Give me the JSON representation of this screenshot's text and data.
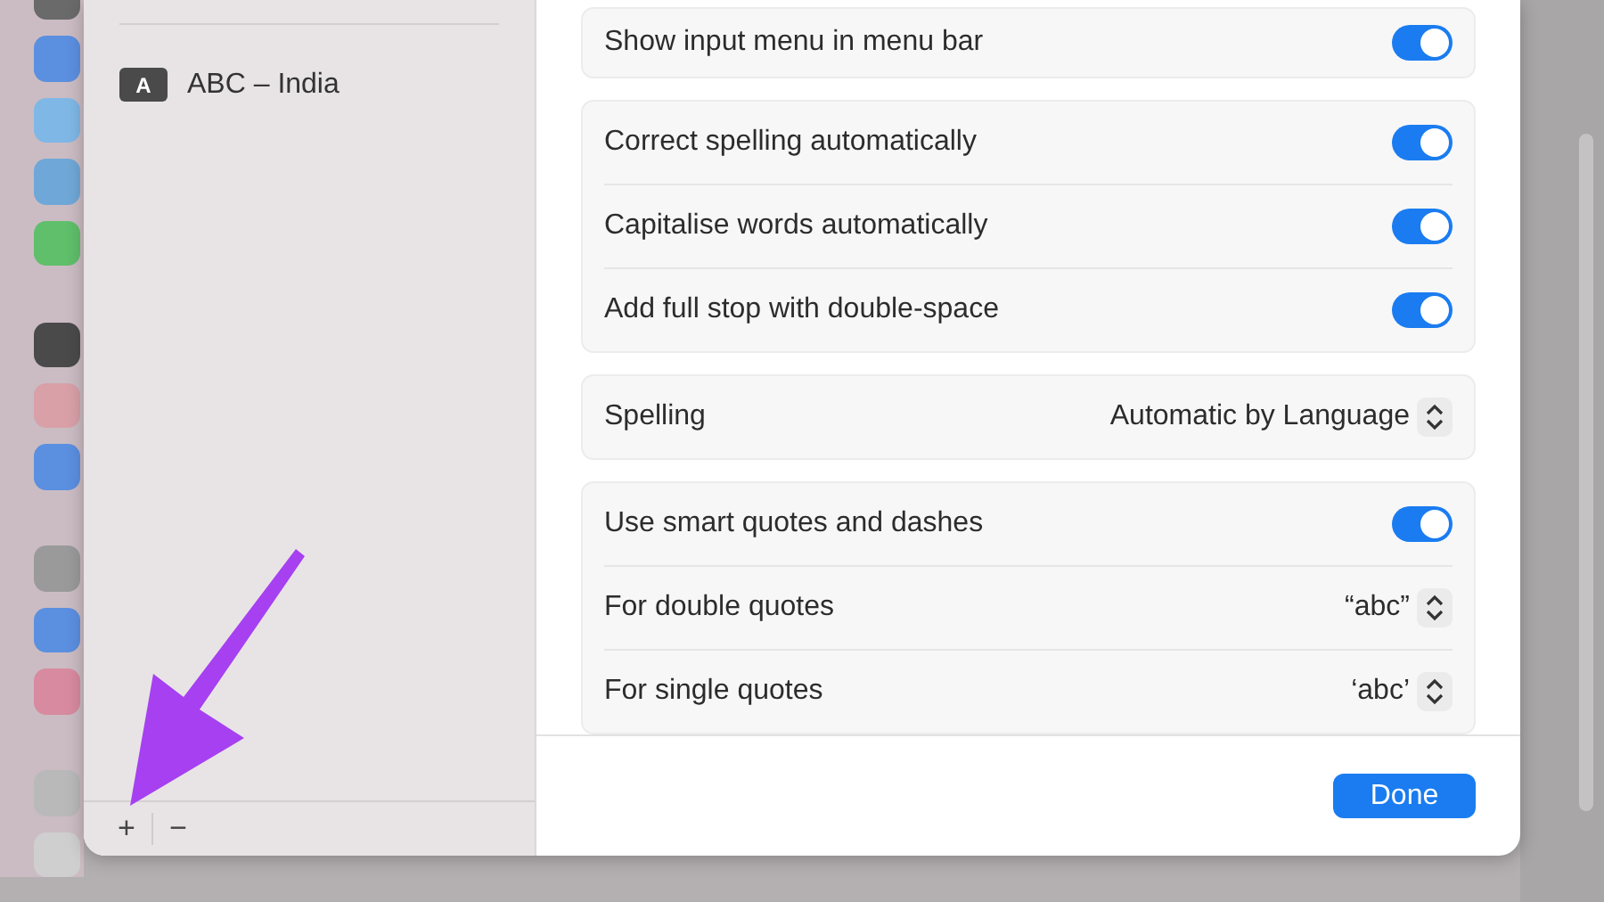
{
  "sidebar": {
    "input_sources": [
      {
        "badge": "A",
        "label": "ABC – India"
      }
    ],
    "add_button": "+",
    "remove_button": "−"
  },
  "settings_groups": [
    {
      "rows": [
        {
          "kind": "toggle",
          "label": "Show input menu in menu bar",
          "on": true
        }
      ]
    },
    {
      "rows": [
        {
          "kind": "toggle",
          "label": "Correct spelling automatically",
          "on": true
        },
        {
          "kind": "toggle",
          "label": "Capitalise words automatically",
          "on": true
        },
        {
          "kind": "toggle",
          "label": "Add full stop with double-space",
          "on": true
        }
      ]
    },
    {
      "rows": [
        {
          "kind": "popup",
          "label": "Spelling",
          "value": "Automatic by Language"
        }
      ]
    },
    {
      "rows": [
        {
          "kind": "toggle",
          "label": "Use smart quotes and dashes",
          "on": true
        },
        {
          "kind": "popup",
          "label": "For double quotes",
          "value": "“abc”"
        },
        {
          "kind": "popup",
          "label": "For single quotes",
          "value": "‘abc’"
        }
      ]
    }
  ],
  "done_button": "Done"
}
